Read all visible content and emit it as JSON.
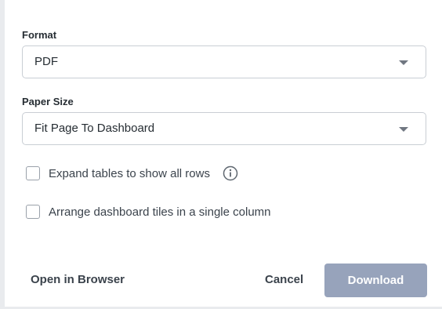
{
  "format": {
    "label": "Format",
    "selected": "PDF"
  },
  "paper_size": {
    "label": "Paper Size",
    "selected": "Fit Page To Dashboard"
  },
  "options": {
    "expand_tables": {
      "label": "Expand tables to show all rows",
      "checked": false,
      "info_icon": "info-icon"
    },
    "single_column": {
      "label": "Arrange dashboard tiles in a single column",
      "checked": false
    }
  },
  "footer": {
    "open_in_browser": "Open in Browser",
    "cancel": "Cancel",
    "download": "Download",
    "download_color": "#97a3bb"
  }
}
